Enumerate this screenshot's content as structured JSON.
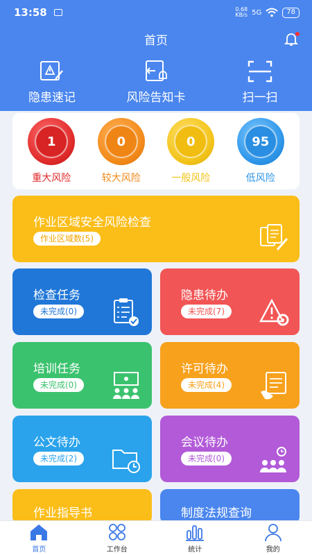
{
  "status": {
    "time": "13:58",
    "net_speed": "0.68",
    "net_unit": "KB/s",
    "signal": "5G",
    "battery": "78"
  },
  "header": {
    "title": "首页"
  },
  "quick_actions": [
    {
      "label": "隐患速记",
      "icon": "edit-warning-icon"
    },
    {
      "label": "风险告知卡",
      "icon": "notice-card-icon"
    },
    {
      "label": "扫一扫",
      "icon": "scan-icon"
    }
  ],
  "risks": [
    {
      "value": "1",
      "label": "重大风险",
      "color": "#e02a2a"
    },
    {
      "value": "0",
      "label": "较大风险",
      "color": "#f28a1a"
    },
    {
      "value": "0",
      "label": "一般风险",
      "color": "#f2c31a"
    },
    {
      "value": "95",
      "label": "低风险",
      "color": "#2d95e8"
    }
  ],
  "tiles": {
    "area_check": {
      "title": "作业区域安全风险检查",
      "badge": "作业区域数(5)",
      "color": "#fbbd18"
    },
    "inspect_task": {
      "title": "检查任务",
      "badge": "未完成(0)",
      "color": "#2077d8"
    },
    "hazard_todo": {
      "title": "隐患待办",
      "badge": "未完成(7)",
      "color": "#f25555"
    },
    "training_task": {
      "title": "培训任务",
      "badge": "未完成(0)",
      "color": "#3bc26e"
    },
    "permit_todo": {
      "title": "许可待办",
      "badge": "未完成(4)",
      "color": "#f7a11c"
    },
    "document_todo": {
      "title": "公文待办",
      "badge": "未完成(2)",
      "color": "#2aa3ec"
    },
    "meeting_todo": {
      "title": "会议待办",
      "badge": "未完成(0)",
      "color": "#b25ad8"
    },
    "work_guide": {
      "title": "作业指导书",
      "color": "#fbbd18"
    },
    "regulation_query": {
      "title": "制度法规查询",
      "color": "#4a86ee"
    }
  },
  "tabs": [
    {
      "label": "首页"
    },
    {
      "label": "工作台"
    },
    {
      "label": "统计"
    },
    {
      "label": "我的"
    }
  ]
}
